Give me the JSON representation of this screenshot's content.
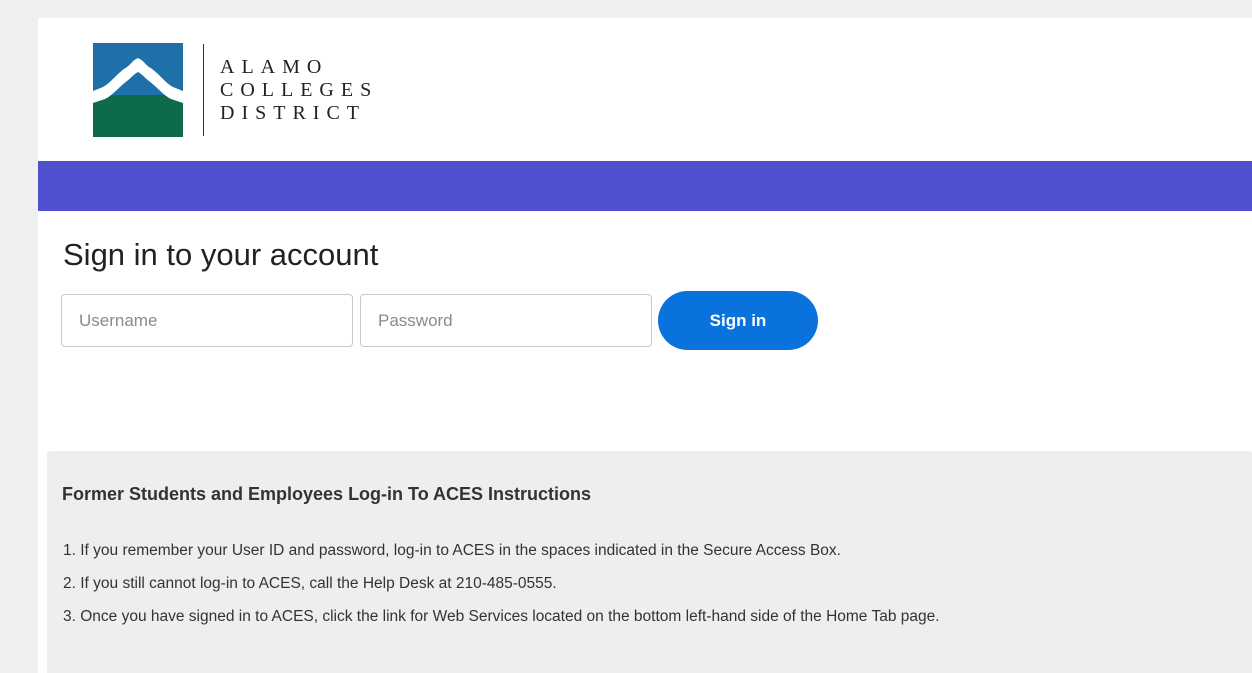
{
  "logo": {
    "lines": [
      "ALAMO",
      "COLLEGES",
      "DISTRICT"
    ],
    "colors": {
      "sky": "#1f6fa8",
      "land": "#0d6b4a",
      "arch": "#ffffff"
    }
  },
  "banner": {
    "color": "#5050d0"
  },
  "signin": {
    "title": "Sign in to your account",
    "username_placeholder": "Username",
    "username_value": "",
    "password_placeholder": "Password",
    "password_value": "",
    "button_label": "Sign in",
    "button_color": "#0a72dc"
  },
  "instructions": {
    "heading": "Former Students and Employees Log-in To ACES Instructions",
    "items": [
      "1. If you remember your User ID and password, log-in to ACES in the spaces indicated in the Secure Access Box.",
      "2. If you still cannot log-in to ACES, call the Help Desk at 210-485-0555.",
      "3. Once you have signed in to ACES, click the link for Web Services located on the bottom left-hand side of the Home Tab page."
    ]
  }
}
